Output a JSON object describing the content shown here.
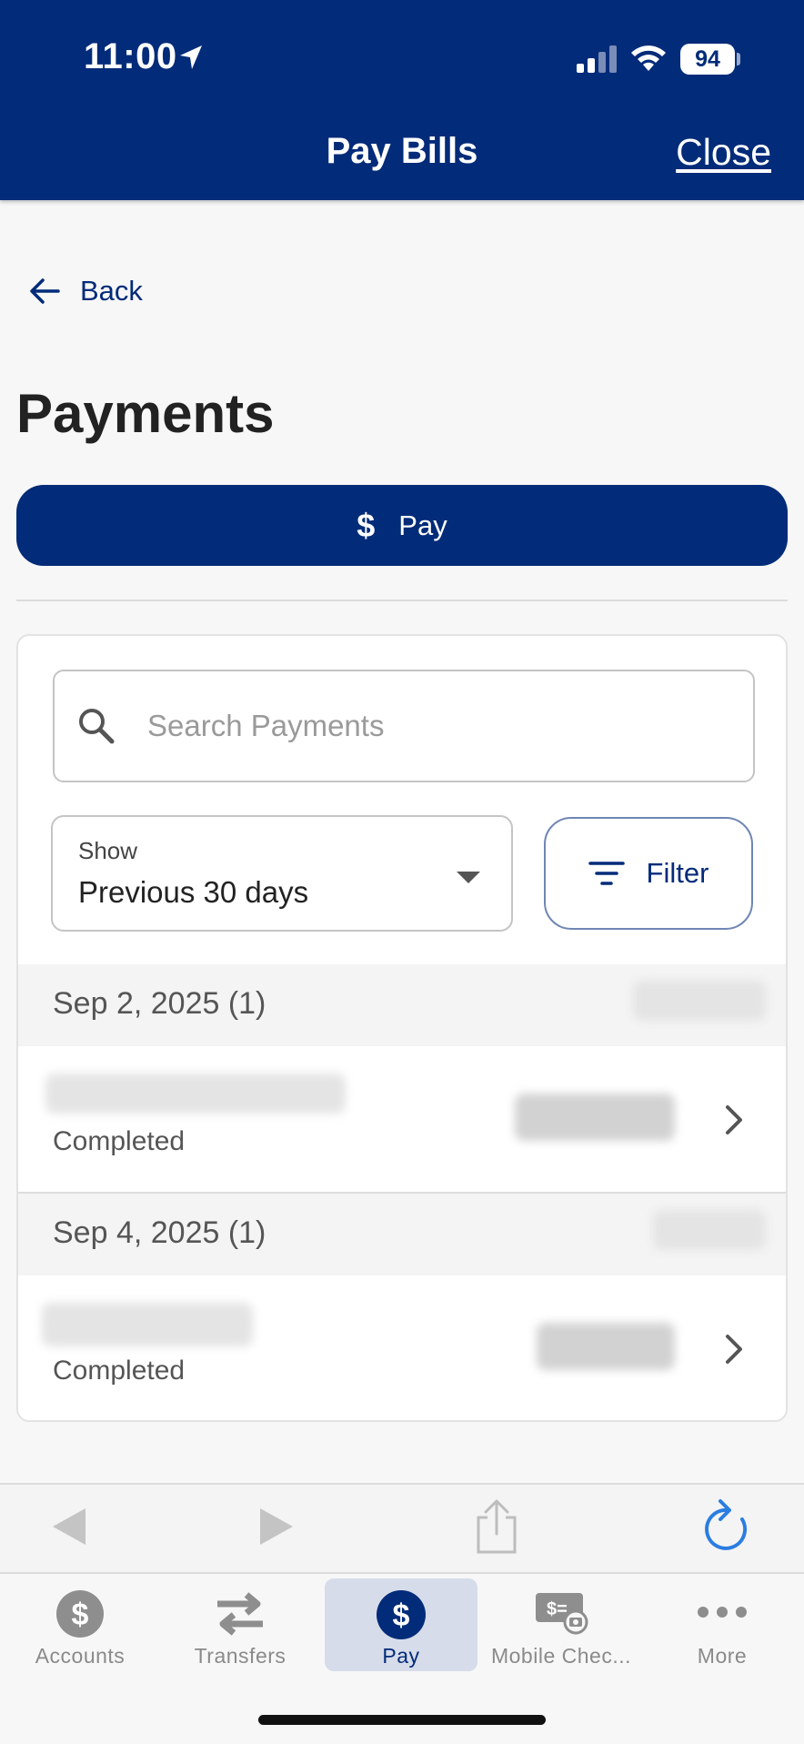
{
  "status_bar": {
    "time": "11:00",
    "battery": "94"
  },
  "header": {
    "title": "Pay Bills",
    "close_label": "Close"
  },
  "nav": {
    "back_label": "Back"
  },
  "page": {
    "title": "Payments",
    "pay_button_label": "Pay",
    "pay_button_icon": "$"
  },
  "search": {
    "placeholder": "Search Payments",
    "value": ""
  },
  "show_filter": {
    "label": "Show",
    "selected": "Previous 30 days"
  },
  "filter_button": {
    "label": "Filter"
  },
  "groups": [
    {
      "date": "Sep 2, 2025 (1)",
      "payments": [
        {
          "status": "Completed"
        }
      ]
    },
    {
      "date": "Sep 4, 2025 (1)",
      "payments": [
        {
          "status": "Completed"
        }
      ]
    }
  ],
  "tabs": [
    {
      "label": "Accounts",
      "icon": "dollar-circle-icon",
      "active": false
    },
    {
      "label": "Transfers",
      "icon": "transfer-arrows-icon",
      "active": false
    },
    {
      "label": "Pay",
      "icon": "dollar-circle-icon",
      "active": true
    },
    {
      "label": "Mobile Chec...",
      "icon": "check-camera-icon",
      "active": false
    },
    {
      "label": "More",
      "icon": "more-dots-icon",
      "active": false
    }
  ],
  "colors": {
    "brand": "#022b79",
    "refresh": "#2a7de1",
    "background": "#f7f7f7"
  }
}
